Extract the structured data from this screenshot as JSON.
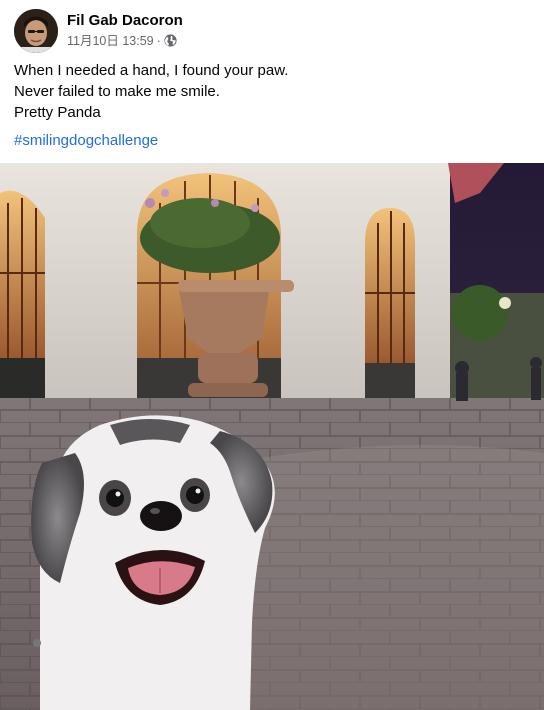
{
  "post": {
    "author": "Fil Gab Dacoron",
    "timestamp": "11月10日 13:59",
    "separator": "·",
    "privacy_icon": "globe-icon",
    "text_lines": [
      "When I needed a hand, I found your paw.",
      "Never failed to make me smile.",
      "Pretty Panda"
    ],
    "hashtag": "#smilingdogchallenge",
    "photo": "smiling white and grey shih tzu dog in front of a lit arched building at night"
  },
  "colors": {
    "link": "#216fdb",
    "meta": "#65676b",
    "text": "#050505"
  }
}
